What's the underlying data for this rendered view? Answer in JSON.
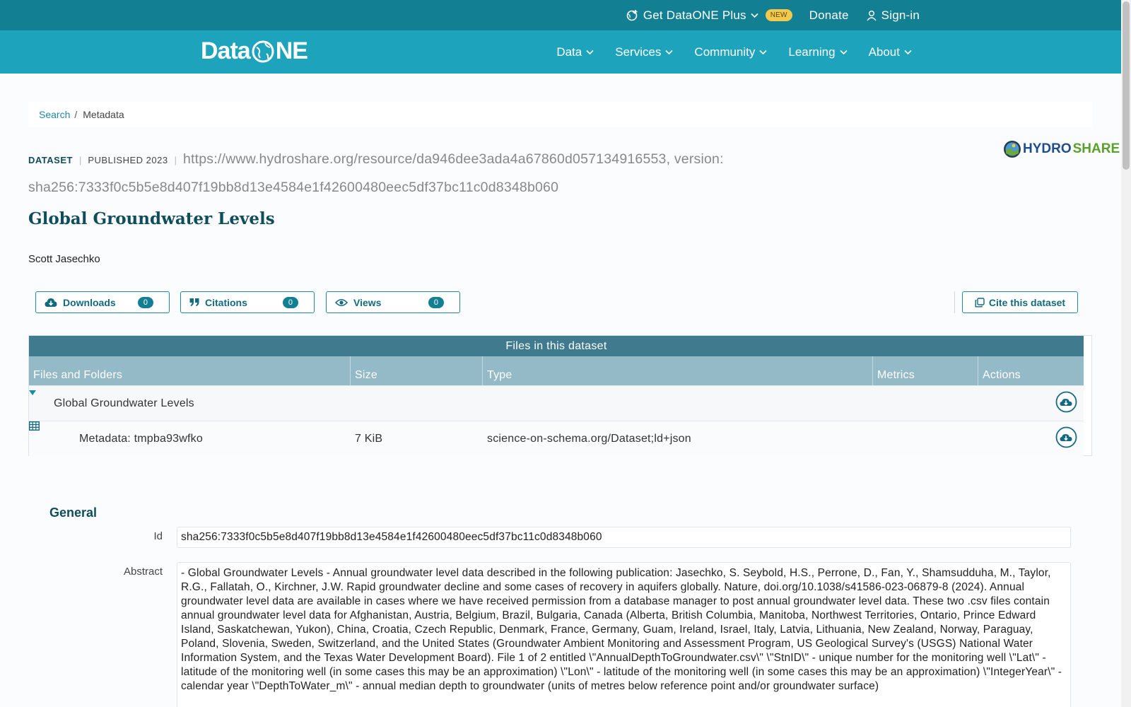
{
  "topbar": {
    "plus_label": "Get DataONE Plus",
    "new_badge": "NEW",
    "donate_label": "Donate",
    "signin_label": "Sign-in"
  },
  "navbar": {
    "logo_left": "Data",
    "logo_right": "NE",
    "items": [
      {
        "label": "Data"
      },
      {
        "label": "Services"
      },
      {
        "label": "Community"
      },
      {
        "label": "Learning"
      },
      {
        "label": "About"
      }
    ]
  },
  "breadcrumb": {
    "search": "Search",
    "separator": "/",
    "current": "Metadata"
  },
  "dataset": {
    "type_tag": "DATASET",
    "published_tag": "PUBLISHED 2023",
    "pid_line": "https://www.hydroshare.org/resource/da946dee3ada4a67860d057134916553, version: sha256:7333f0c5b5e8d407f19bb8d13e4584e1f42600480eec5df37bc11c0d8348b060",
    "repository_logo_text_a": "HYDRO",
    "repository_logo_text_b": "SHARE",
    "title": "Global Groundwater Levels",
    "author": "Scott Jasechko"
  },
  "metrics": {
    "downloads_label": "Downloads",
    "downloads_count": "0",
    "citations_label": "Citations",
    "citations_count": "0",
    "views_label": "Views",
    "views_count": "0",
    "cite_label": "Cite this dataset"
  },
  "files": {
    "heading": "Files in this dataset",
    "columns": [
      "Files and Folders",
      "Size",
      "Type",
      "Metrics",
      "Actions"
    ],
    "folder_name": "Global Groundwater Levels",
    "file_name": "Metadata: tmpba93wfko",
    "file_size": "7 KiB",
    "file_type": "science-on-schema.org/Dataset;ld+json"
  },
  "general": {
    "heading": "General",
    "id_label": "Id",
    "id_value": "sha256:7333f0c5b5e8d407f19bb8d13e4584e1f42600480eec5df37bc11c0d8348b060",
    "abstract_label": "Abstract",
    "abstract_value": "- Global Groundwater Levels - Annual groundwater level data described in the following publication: Jasechko, S. Seybold, H.S., Perrone, D., Fan, Y., Shamsudduha, M., Taylor, R.G., Fallatah, O., Kirchner, J.W. Rapid groundwater decline and some cases of recovery in aquifers globally. Nature, doi.org/10.1038/s41586-023-06879-8 (2024). Annual groundwater level data are available in cases where we have received permission from a database manager to post annual groundwater level data. These two .csv files contain annual groundwater level data for Afghanistan, Austria, Belgium, Brazil, Bulgaria, Canada (Alberta, British Columbia, Manitoba, Northwest Territories, Ontario, Prince Edward Island, Saskatchewan, Yukon), China, Croatia, Czech Republic, Denmark, France, Germany, Guam, Ireland, Israel, Italy, Latvia, Lithuania, New Zealand, Norway, Paraguay, Poland, Slovenia, Sweden, Switzerland, and the United States (Groundwater Ambient Monitoring and Assessment Program, US Geological Survey's (USGS) National Water Information System, and the Texas Water Development Board). File 1 of 2 entitled \\\"AnnualDepthToGroundwater.csv\\\" \\\"StnID\\\" - unique number for the monitoring well \\\"Lat\\\" - latitude of the monitoring well (in some cases this may be an approximation) \\\"Lon\\\" - latitude of the monitoring well (in some cases this may be an approximation) \\\"IntegerYear\\\" - calendar year \\\"DepthToWater_m\\\" - annual median depth to groundwater (units of metres below reference point and/or groundwater surface)"
  },
  "colors": {
    "topbar": "#137f93",
    "navbar": "#1ea3bc",
    "accent": "#1e8aa6",
    "title": "#0f4c5c"
  }
}
